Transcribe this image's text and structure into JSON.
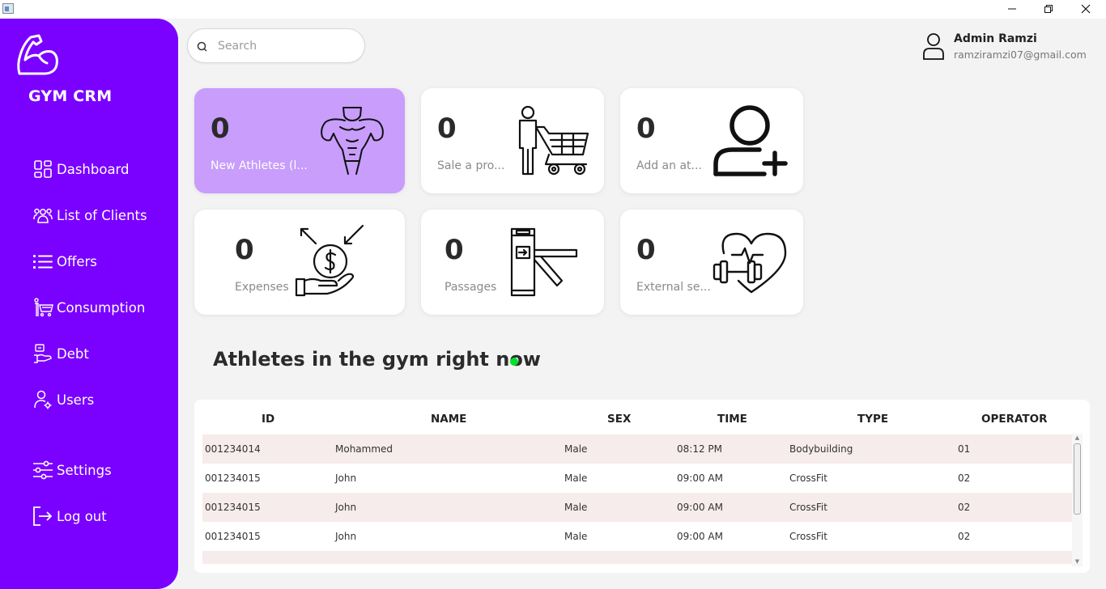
{
  "app": {
    "brand": "GYM CRM"
  },
  "sidebar": {
    "items": [
      {
        "label": "Dashboard",
        "icon": "dashboard-grid-icon"
      },
      {
        "label": "List of Clients",
        "icon": "people-group-icon"
      },
      {
        "label": "Offers",
        "icon": "list-icon"
      },
      {
        "label": "Consumption",
        "icon": "shopper-cart-icon"
      },
      {
        "label": "Debt",
        "icon": "debt-hand-icon"
      },
      {
        "label": "Users",
        "icon": "user-gear-icon"
      },
      {
        "label": "Settings",
        "icon": "sliders-icon"
      },
      {
        "label": "Log out",
        "icon": "logout-icon"
      }
    ]
  },
  "search": {
    "placeholder": "Search",
    "value": ""
  },
  "user": {
    "name": "Admin Ramzi",
    "email": "ramziramzi07@gmail.com"
  },
  "cards": [
    {
      "count": "0",
      "label": "New Athletes (l...",
      "icon": "bodybuilder-icon"
    },
    {
      "count": "0",
      "label": "Sale a pro...",
      "icon": "shopping-cart-person-icon"
    },
    {
      "count": "0",
      "label": "Add an at...",
      "icon": "add-user-icon"
    },
    {
      "count": "0",
      "label": "Expenses",
      "icon": "expenses-coin-hand-icon"
    },
    {
      "count": "0",
      "label": "Passages",
      "icon": "turnstile-gate-icon"
    },
    {
      "count": "0",
      "label": "External se...",
      "icon": "heart-dumbbell-icon"
    }
  ],
  "section": {
    "title": "Athletes in the gym right now"
  },
  "table": {
    "headers": [
      "ID",
      "NAME",
      "SEX",
      "TIME",
      "TYPE",
      "OPERATOR"
    ],
    "rows": [
      [
        "001234014",
        "Mohammed",
        "Male",
        "08:12 PM",
        "Bodybuilding",
        "01"
      ],
      [
        "001234015",
        "John",
        "Male",
        "09:00 AM",
        "CrossFit",
        "02"
      ],
      [
        "001234015",
        "John",
        "Male",
        "09:00 AM",
        "CrossFit",
        "02"
      ],
      [
        "001234015",
        "John",
        "Male",
        "09:00 AM",
        "CrossFit",
        "02"
      ]
    ]
  },
  "colors": {
    "sidebar": "#7a00ff",
    "active_card": "#c89dfb",
    "live_dot": "#00e02a",
    "row_alt": "#f6eceb"
  }
}
